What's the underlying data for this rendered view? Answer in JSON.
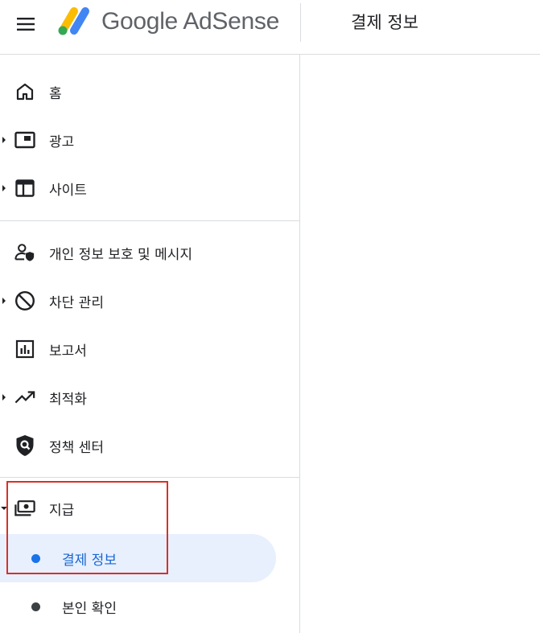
{
  "header": {
    "menu_icon": "hamburger-menu-icon",
    "logo_text": "Google AdSense",
    "logo_colors": [
      "#fbbc04",
      "#34a853",
      "#4285f4"
    ],
    "page_title": "결제 정보"
  },
  "sidebar": {
    "items": [
      {
        "label": "홈",
        "icon": "home-icon",
        "expandable": false
      },
      {
        "label": "광고",
        "icon": "ads-icon",
        "expandable": true
      },
      {
        "label": "사이트",
        "icon": "sites-icon",
        "expandable": true
      },
      {
        "label": "개인 정보 보호 및 메시지",
        "icon": "privacy-messaging-icon",
        "expandable": false
      },
      {
        "label": "차단 관리",
        "icon": "block-icon",
        "expandable": true
      },
      {
        "label": "보고서",
        "icon": "reports-icon",
        "expandable": false
      },
      {
        "label": "최적화",
        "icon": "optimization-icon",
        "expandable": true
      },
      {
        "label": "정책 센터",
        "icon": "policy-center-icon",
        "expandable": false
      },
      {
        "label": "지급",
        "icon": "payments-icon",
        "expandable": true,
        "expanded": true
      }
    ],
    "payments_subitems": [
      {
        "label": "결제 정보",
        "active": true
      },
      {
        "label": "본인 확인",
        "active": false
      }
    ]
  },
  "colors": {
    "active_bg": "#e8f0fe",
    "active_text": "#1967d2",
    "highlight_border": "#d93025"
  }
}
